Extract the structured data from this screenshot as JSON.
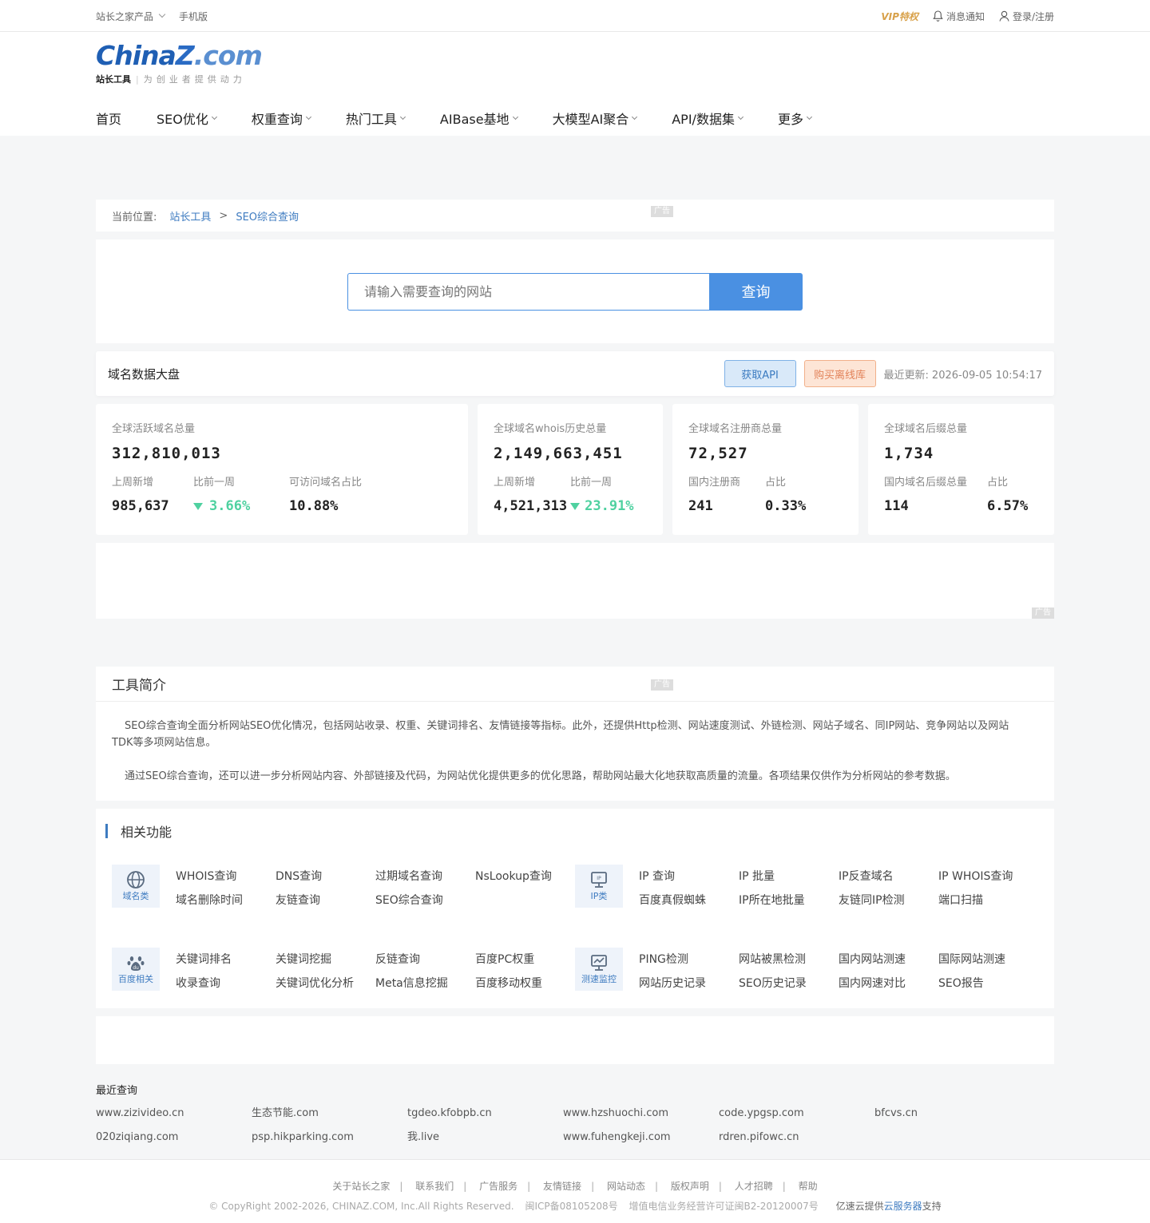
{
  "topbar": {
    "products": "站长之家产品",
    "mobile": "手机版",
    "vip": "VIP特权",
    "notify": "消息通知",
    "login": "登录/注册"
  },
  "logo": {
    "part1": "China",
    "part2": "Z",
    "part3": ".com",
    "sub_brand": "站长工具",
    "slogan": "为创业者提供动力"
  },
  "nav": [
    {
      "label": "首页"
    },
    {
      "label": "SEO优化"
    },
    {
      "label": "权重查询"
    },
    {
      "label": "热门工具"
    },
    {
      "label": "AIBase基地"
    },
    {
      "label": "大模型AI聚合"
    },
    {
      "label": "API/数据集"
    },
    {
      "label": "更多"
    }
  ],
  "breadcrumb": {
    "prefix": "当前位置:",
    "crumbs": [
      "站长工具",
      "SEO综合查询"
    ],
    "sep": ">"
  },
  "ad_label": "广告",
  "search": {
    "placeholder": "请输入需要查询的网站",
    "button": "查询"
  },
  "domain_data": {
    "title": "域名数据大盘",
    "api_btn": "获取API",
    "buy_btn": "购买离线库",
    "updated_label": "最近更新:",
    "updated_value": "2026-09-05 10:54:17"
  },
  "stats": {
    "s1": {
      "label": "全球活跃域名总量",
      "total": "312,810,013",
      "l1": "上周新增",
      "l2": "比前一周",
      "l3": "可访问域名占比",
      "v1": "985,637",
      "v2": "3.66%",
      "v3": "10.88%"
    },
    "s2": {
      "label": "全球域名whois历史总量",
      "total": "2,149,663,451",
      "l1": "上周新增",
      "l2": "比前一周",
      "v1": "4,521,313",
      "v2": "23.91%"
    },
    "s3": {
      "label": "全球域名注册商总量",
      "total": "72,527",
      "l1": "国内注册商",
      "l2": "占比",
      "v1": "241",
      "v2": "0.33%"
    },
    "s4": {
      "label": "全球域名后缀总量",
      "total": "1,734",
      "l1": "国内域名后缀总量",
      "l2": "占比",
      "v1": "114",
      "v2": "6.57%"
    }
  },
  "intro": {
    "title": "工具简介",
    "p1": "SEO综合查询全面分析网站SEO优化情况，包括网站收录、权重、关键词排名、友情链接等指标。此外，还提供Http检测、网站速度测试、外链检测、网站子域名、同IP网站、竞争网站以及网站TDK等多项网站信息。",
    "p2": "通过SEO综合查询，还可以进一步分析网站内容、外部链接及代码，为网站优化提供更多的优化思路，帮助网站最大化地获取高质量的流量。各项结果仅供作为分析网站的参考数据。"
  },
  "related": {
    "title": "相关功能",
    "groups": [
      {
        "name": "域名类",
        "icon": "www",
        "links": [
          "WHOIS查询",
          "DNS查询",
          "过期域名查询",
          "NsLookup查询",
          "域名删除时间",
          "友链查询",
          "SEO综合查询",
          ""
        ]
      },
      {
        "name": "IP类",
        "icon": "IP",
        "links": [
          "IP 查询",
          "IP 批量",
          "IP反查域名",
          "IP WHOIS查询",
          "百度真假蜘蛛",
          "IP所在地批量",
          "友链同IP检测",
          "端口扫描"
        ]
      },
      {
        "name": "百度相关",
        "icon": "du",
        "links": [
          "关键词排名",
          "关键词挖掘",
          "反链查询",
          "百度PC权重",
          "收录查询",
          "关键词优化分析",
          "Meta信息挖掘",
          "百度移动权重"
        ]
      },
      {
        "name": "测速监控",
        "icon": "chart",
        "links": [
          "PING检测",
          "网站被黑检测",
          "国内网站测速",
          "国际网站测速",
          "网站历史记录",
          "SEO历史记录",
          "国内网速对比",
          "SEO报告"
        ]
      }
    ]
  },
  "recent": {
    "title": "最近查询",
    "items": [
      "www.zizivideo.cn",
      "生态节能.com",
      "tgdeo.kfobpb.cn",
      "www.hzshuochi.com",
      "code.ypgsp.com",
      "bfcvs.cn",
      "020ziqiang.com",
      "psp.hikparking.com",
      "我.live",
      "www.fuhengkeji.com",
      "rdren.pifowc.cn",
      ""
    ]
  },
  "footer": {
    "links": [
      "关于站长之家",
      "联系我们",
      "广告服务",
      "友情链接",
      "网站动态",
      "版权声明",
      "人才招聘",
      "帮助"
    ],
    "copyright": "© CopyRight 2002-2026, CHINAZ.COM, Inc.All Rights Reserved.",
    "icp": "闽ICP备08105208号",
    "license": "增值电信业务经营许可证闽B2-20120007号",
    "cloud_prefix": "亿速云提供",
    "cloud_link": "云服务器",
    "cloud_suffix": "支持"
  },
  "colors": {
    "accent": "#4a90e2",
    "link": "#3e7bc0",
    "up_green": "#4fd1a0",
    "vip_gold": "#d8a14a"
  }
}
